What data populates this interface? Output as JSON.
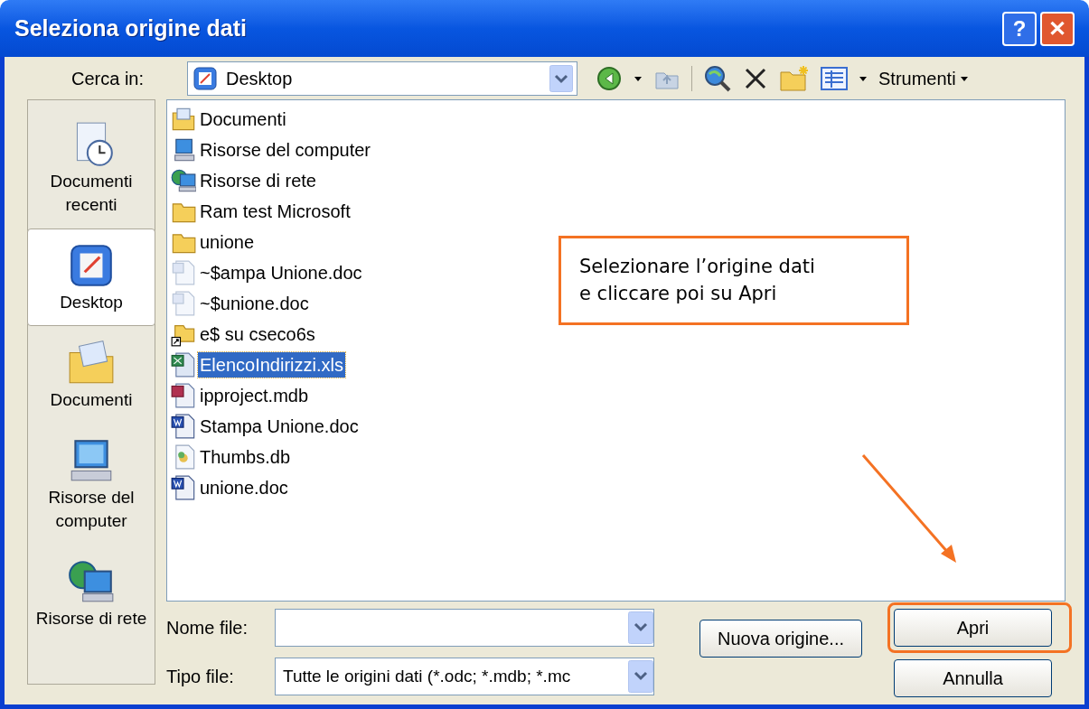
{
  "window": {
    "title": "Seleziona origine dati",
    "controls": [
      {
        "kind": "help",
        "label": "?"
      },
      {
        "kind": "close",
        "label": "✕"
      }
    ]
  },
  "look_in": {
    "label": "Cerca in:",
    "value": "Desktop"
  },
  "toolbar": {
    "tools_label": "Strumenti"
  },
  "places": [
    {
      "label": "Documenti recenti",
      "kind": "recent",
      "selected": false
    },
    {
      "label": "Desktop",
      "kind": "desktop",
      "selected": true
    },
    {
      "label": "Documenti",
      "kind": "documents",
      "selected": false
    },
    {
      "label": "Risorse del computer",
      "kind": "computer",
      "selected": false
    },
    {
      "label": "Risorse di rete",
      "kind": "network",
      "selected": false
    }
  ],
  "files": [
    {
      "name": "Documenti",
      "kind": "docfolder",
      "selected": false
    },
    {
      "name": "Risorse del computer",
      "kind": "computer",
      "selected": false
    },
    {
      "name": "Risorse di rete",
      "kind": "network",
      "selected": false
    },
    {
      "name": "Ram test Microsoft",
      "kind": "folder",
      "selected": false
    },
    {
      "name": "unione",
      "kind": "folder",
      "selected": false
    },
    {
      "name": "~$ampa Unione.doc",
      "kind": "wordtemp",
      "selected": false
    },
    {
      "name": "~$unione.doc",
      "kind": "wordtemp",
      "selected": false
    },
    {
      "name": "e$ su cseco6s",
      "kind": "share",
      "selected": false
    },
    {
      "name": "ElencoIndirizzi.xls",
      "kind": "excel",
      "selected": true
    },
    {
      "name": "ipproject.mdb",
      "kind": "access",
      "selected": false
    },
    {
      "name": "Stampa Unione.doc",
      "kind": "word",
      "selected": false
    },
    {
      "name": "Thumbs.db",
      "kind": "db",
      "selected": false
    },
    {
      "name": "unione.doc",
      "kind": "word",
      "selected": false
    }
  ],
  "file_name": {
    "label": "Nome file:"
  },
  "file_type": {
    "label": "Tipo file:",
    "value": "Tutte le origini dati (*.odc; *.mdb; *.mc"
  },
  "buttons": [
    {
      "label": "Nuova origine...",
      "highlighted": false
    },
    {
      "label": "Apri",
      "highlighted": true
    },
    {
      "label": "Annulla",
      "highlighted": false
    }
  ],
  "callout": {
    "text": "Selezionare l’origine dati\ne cliccare poi su Apri"
  }
}
